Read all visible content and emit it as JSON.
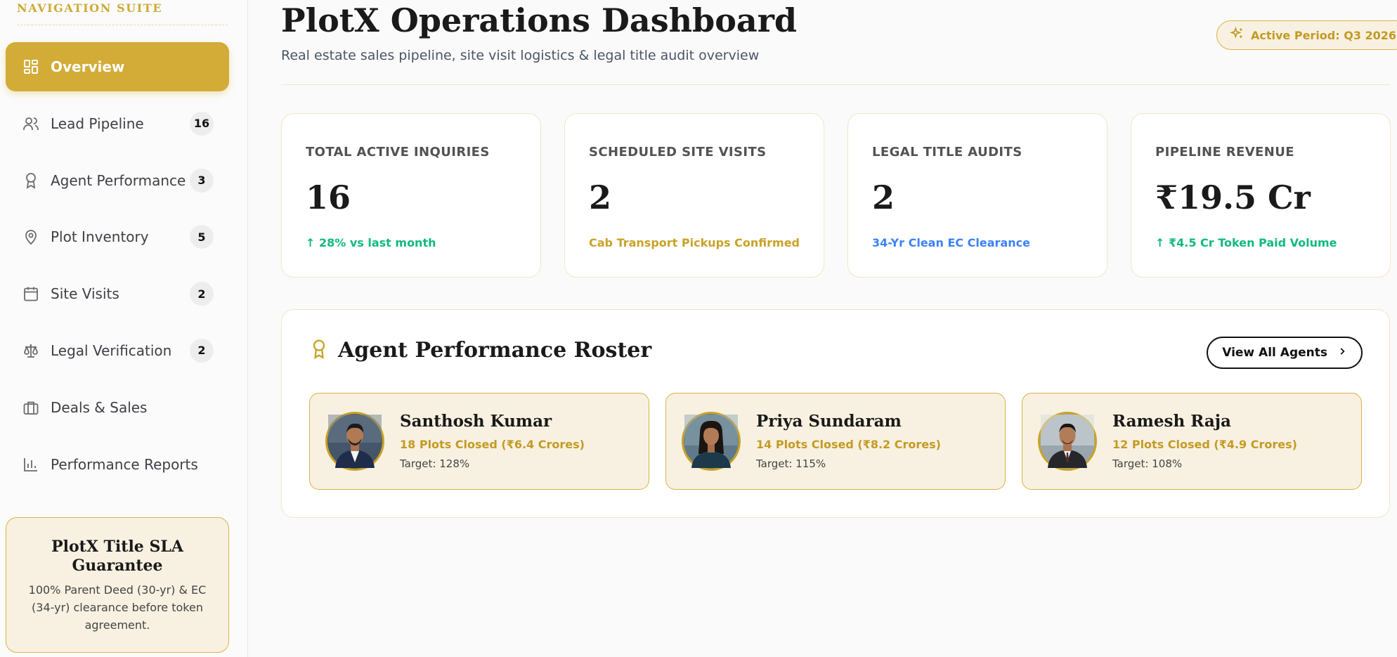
{
  "sidebar": {
    "section_title": "NAVIGATION SUITE",
    "items": [
      {
        "label": "Overview",
        "icon": "grid-icon",
        "badge": ""
      },
      {
        "label": "Lead Pipeline",
        "icon": "users-icon",
        "badge": "16"
      },
      {
        "label": "Agent Performance",
        "icon": "award-icon",
        "badge": "3"
      },
      {
        "label": "Plot Inventory",
        "icon": "map-pin-icon",
        "badge": "5"
      },
      {
        "label": "Site Visits",
        "icon": "calendar-icon",
        "badge": "2"
      },
      {
        "label": "Legal Verification",
        "icon": "scale-icon",
        "badge": "2"
      },
      {
        "label": "Deals & Sales",
        "icon": "briefcase-icon",
        "badge": ""
      },
      {
        "label": "Performance Reports",
        "icon": "bar-chart-icon",
        "badge": ""
      }
    ],
    "sla": {
      "title": "PlotX Title SLA Guarantee",
      "description": "100% Parent Deed (30-yr) & EC (34-yr) clearance before token agreement."
    }
  },
  "header": {
    "title": "PlotX Operations Dashboard",
    "subtitle": "Real estate sales pipeline, site visit logistics & legal title audit overview",
    "period": "Active Period: Q3 2026"
  },
  "kpis": [
    {
      "label": "TOTAL ACTIVE INQUIRIES",
      "value": "16",
      "sub": "↑ 28% vs last month",
      "sub_color": "#10b981"
    },
    {
      "label": "SCHEDULED SITE VISITS",
      "value": "2",
      "sub": "Cab Transport Pickups Confirmed",
      "sub_color": "#c9a227"
    },
    {
      "label": "LEGAL TITLE AUDITS",
      "value": "2",
      "sub": "34-Yr Clean EC Clearance",
      "sub_color": "#3b82f6"
    },
    {
      "label": "PIPELINE REVENUE",
      "value": "₹19.5 Cr",
      "sub": "↑ ₹4.5 Cr Token Paid Volume",
      "sub_color": "#10b981"
    }
  ],
  "roster": {
    "title": "Agent Performance Roster",
    "view_all": "View All Agents",
    "agents": [
      {
        "name": "Santhosh Kumar",
        "plots": "18 Plots Closed (₹6.4 Crores)",
        "target": "Target: 128%"
      },
      {
        "name": "Priya Sundaram",
        "plots": "14 Plots Closed (₹8.2 Crores)",
        "target": "Target: 115%"
      },
      {
        "name": "Ramesh Raja",
        "plots": "12 Plots Closed (₹4.9 Crores)",
        "target": "Target: 108%"
      }
    ]
  },
  "colors": {
    "accent": "#d3ab37",
    "accent_text": "#c49a24",
    "accent_soft": "#f8f1e1",
    "positive": "#10b981",
    "info": "#3b82f6"
  }
}
